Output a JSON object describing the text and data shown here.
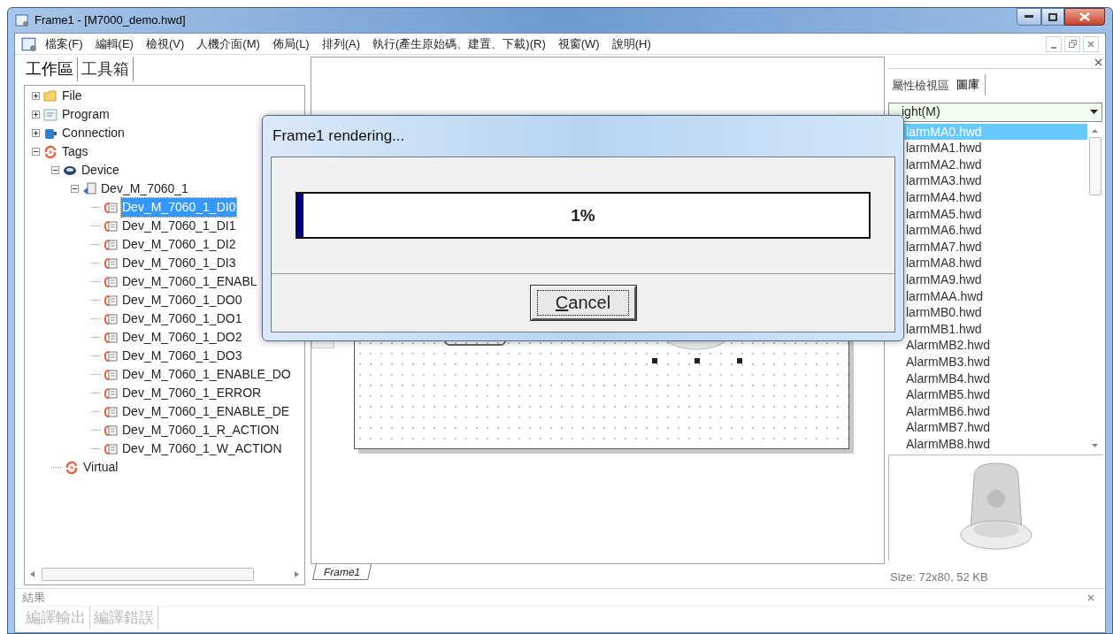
{
  "window": {
    "title": "Frame1 - [M7000_demo.hwd]"
  },
  "menu": [
    "檔案(F)",
    "編輯(E)",
    "檢視(V)",
    "人機介面(M)",
    "佈局(L)",
    "排列(A)",
    "執行(產生原始碼、建置、下載)(R)",
    "視窗(W)",
    "說明(H)"
  ],
  "left_panel": {
    "tabs": [
      {
        "label": "工作區",
        "selected": true
      },
      {
        "label": "工具箱",
        "selected": false
      }
    ],
    "tree": [
      {
        "label": "File",
        "kind": "folder",
        "expanded": false,
        "selected": false
      },
      {
        "label": "Program",
        "kind": "program",
        "expanded": false,
        "selected": false
      },
      {
        "label": "Connection",
        "kind": "connection",
        "expanded": false,
        "selected": false
      },
      {
        "label": "Tags",
        "kind": "tags",
        "expanded": true,
        "selected": false,
        "children": [
          {
            "label": "Device",
            "kind": "device",
            "expanded": true,
            "selected": false,
            "children": [
              {
                "label": "Dev_M_7060_1",
                "kind": "module",
                "expanded": true,
                "selected": false,
                "children": [
                  {
                    "label": "Dev_M_7060_1_DI0",
                    "kind": "tag",
                    "selected": true
                  },
                  {
                    "label": "Dev_M_7060_1_DI1",
                    "kind": "tag",
                    "selected": false
                  },
                  {
                    "label": "Dev_M_7060_1_DI2",
                    "kind": "tag",
                    "selected": false
                  },
                  {
                    "label": "Dev_M_7060_1_DI3",
                    "kind": "tag",
                    "selected": false
                  },
                  {
                    "label": "Dev_M_7060_1_ENABL",
                    "kind": "tag",
                    "selected": false
                  },
                  {
                    "label": "Dev_M_7060_1_DO0",
                    "kind": "tag",
                    "selected": false
                  },
                  {
                    "label": "Dev_M_7060_1_DO1",
                    "kind": "tag",
                    "selected": false
                  },
                  {
                    "label": "Dev_M_7060_1_DO2",
                    "kind": "tag",
                    "selected": false
                  },
                  {
                    "label": "Dev_M_7060_1_DO3",
                    "kind": "tag",
                    "selected": false
                  },
                  {
                    "label": "Dev_M_7060_1_ENABLE_DO",
                    "kind": "tag",
                    "selected": false
                  },
                  {
                    "label": "Dev_M_7060_1_ERROR",
                    "kind": "tag",
                    "selected": false
                  },
                  {
                    "label": "Dev_M_7060_1_ENABLE_DE",
                    "kind": "tag",
                    "selected": false
                  },
                  {
                    "label": "Dev_M_7060_1_R_ACTION",
                    "kind": "tag",
                    "selected": false
                  },
                  {
                    "label": "Dev_M_7060_1_W_ACTION",
                    "kind": "tag",
                    "selected": false
                  }
                ]
              }
            ]
          },
          {
            "label": "Virtual",
            "kind": "tags",
            "selected": false
          }
        ]
      }
    ]
  },
  "editor": {
    "tabs": [
      {
        "label": "Frame1",
        "selected": true
      }
    ]
  },
  "right_panel": {
    "tabs": [
      {
        "label": "屬性檢視區",
        "selected": false
      },
      {
        "label": "圖庫",
        "selected": true
      }
    ],
    "category": "ight(M)",
    "files": [
      {
        "label": "larmMA0.hwd",
        "selected": true
      },
      {
        "label": "larmMA1.hwd",
        "selected": false
      },
      {
        "label": "larmMA2.hwd",
        "selected": false
      },
      {
        "label": "larmMA3.hwd",
        "selected": false
      },
      {
        "label": "larmMA4.hwd",
        "selected": false
      },
      {
        "label": "larmMA5.hwd",
        "selected": false
      },
      {
        "label": "larmMA6.hwd",
        "selected": false
      },
      {
        "label": "larmMA7.hwd",
        "selected": false
      },
      {
        "label": "larmMA8.hwd",
        "selected": false
      },
      {
        "label": "larmMA9.hwd",
        "selected": false
      },
      {
        "label": "larmMAA.hwd",
        "selected": false
      },
      {
        "label": "larmMB0.hwd",
        "selected": false
      },
      {
        "label": "larmMB1.hwd",
        "selected": false
      },
      {
        "label": "AlarmMB2.hwd",
        "selected": false
      },
      {
        "label": "AlarmMB3.hwd",
        "selected": false
      },
      {
        "label": "AlarmMB4.hwd",
        "selected": false
      },
      {
        "label": "AlarmMB5.hwd",
        "selected": false
      },
      {
        "label": "AlarmMB6.hwd",
        "selected": false
      },
      {
        "label": "AlarmMB7.hwd",
        "selected": false
      },
      {
        "label": "AlarmMB8.hwd",
        "selected": false
      }
    ],
    "preview_info": "Size: 72x80, 52 KB"
  },
  "results": {
    "title": "結果",
    "tabs": [
      {
        "label": "編譯輸出",
        "disabled": true
      },
      {
        "label": "編譯錯誤",
        "disabled": true
      }
    ]
  },
  "dialog": {
    "title": "Frame1 rendering...",
    "progress": {
      "level": 0.01,
      "reading": "1%"
    },
    "button": {
      "label": "Cancel"
    }
  }
}
